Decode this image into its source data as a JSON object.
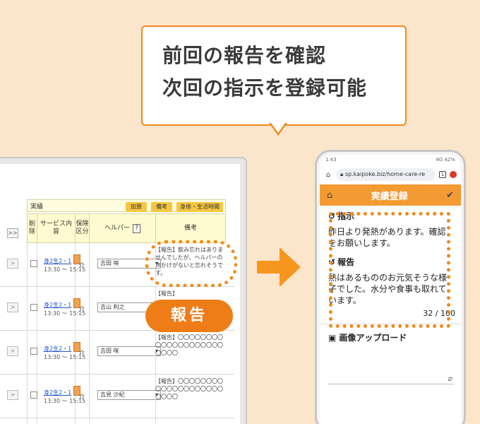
{
  "bubble": {
    "line1": "前回の報告を確認",
    "line2": "次回の指示を登録可能"
  },
  "desktop": {
    "jisseki_label": "実績",
    "header_buttons": [
      "加算",
      "備考",
      "身体・生活時間"
    ],
    "expand_label": ">>",
    "columns": [
      "削除",
      "サービス内容",
      "保険区分",
      "ヘルパー",
      "備考"
    ],
    "help_label": "?",
    "rows": [
      {
        "service": "身2生2・1",
        "time": "13:30 〜 15:15",
        "ins": "介",
        "helper": "吉田 咲",
        "note": "【報告】飲み忘れはありませんでしたが、ヘルパーの声かけがないと忘れそうです。"
      },
      {
        "service": "身2生2・1",
        "time": "13:30 〜 15:15",
        "ins": "介",
        "helper": "吉山 利之",
        "note": "【報告】"
      },
      {
        "service": "身2生2・1",
        "time": "13:30 〜 15:15",
        "ins": "介",
        "helper": "吉田 咲",
        "note": "【報告】〇〇〇〇〇〇〇〇〇〇〇〇〇〇〇〇〇〇〇〇〇〇〇〇"
      },
      {
        "service": "身2生2・1",
        "time": "13:30 〜 15:15",
        "ins": "介",
        "helper": "吉見 沙紀",
        "note": "【報告】〇〇〇〇〇〇〇〇〇〇〇〇〇〇〇〇〇〇〇〇〇〇〇〇"
      }
    ],
    "row_button": ">"
  },
  "report_pill": "報告",
  "phone": {
    "status_left": "1:43",
    "status_right": "4G 42%",
    "url": "sp.kaipoke.biz/home-care-re",
    "tab_count": "1",
    "header_title": "実績登録",
    "home_icon": "home-icon",
    "check_icon": "check-icon",
    "instruction_label": "指示",
    "instruction_text": "昨日より発熱があります。確認をお願いします。",
    "report_label": "報告",
    "report_text": "熱はあるもののお元気そうな様子でした。水分や食事も取れています。",
    "counter": "32 / 100",
    "upload_label": "画像アップロード"
  },
  "colors": {
    "background": "#fbe5cb",
    "accent": "#ee7d18",
    "header": "#f39a33"
  }
}
